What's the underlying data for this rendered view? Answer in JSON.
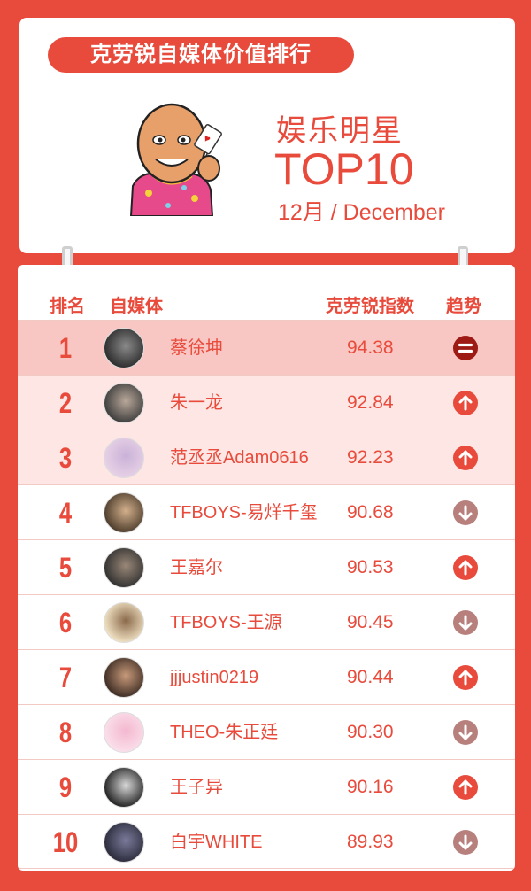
{
  "header": {
    "title": "克劳锐自媒体价值排行",
    "category": "娱乐明星",
    "top_label": "TOP10",
    "date": "12月 / December"
  },
  "table": {
    "headers": {
      "rank": "排名",
      "media": "自媒体",
      "index": "克劳锐指数",
      "trend": "趋势"
    },
    "rows": [
      {
        "rank": "1",
        "name": "蔡徐坤",
        "score": "94.38",
        "trend": "equal"
      },
      {
        "rank": "2",
        "name": "朱一龙",
        "score": "92.84",
        "trend": "up"
      },
      {
        "rank": "3",
        "name": "范丞丞Adam0616",
        "score": "92.23",
        "trend": "up"
      },
      {
        "rank": "4",
        "name": "TFBOYS-易烊千玺",
        "score": "90.68",
        "trend": "down"
      },
      {
        "rank": "5",
        "name": "王嘉尔",
        "score": "90.53",
        "trend": "up"
      },
      {
        "rank": "6",
        "name": "TFBOYS-王源",
        "score": "90.45",
        "trend": "down"
      },
      {
        "rank": "7",
        "name": "jjjustin0219",
        "score": "90.44",
        "trend": "up"
      },
      {
        "rank": "8",
        "name": "THEO-朱正廷",
        "score": "90.30",
        "trend": "down"
      },
      {
        "rank": "9",
        "name": "王子异",
        "score": "90.16",
        "trend": "up"
      },
      {
        "rank": "10",
        "name": "白宇WHITE",
        "score": "89.93",
        "trend": "down"
      }
    ]
  },
  "colors": {
    "brand_red": "#e84b3c",
    "trend_up": "#e84b3c",
    "trend_down": "#b8807c",
    "trend_equal": "#9e1a14"
  }
}
